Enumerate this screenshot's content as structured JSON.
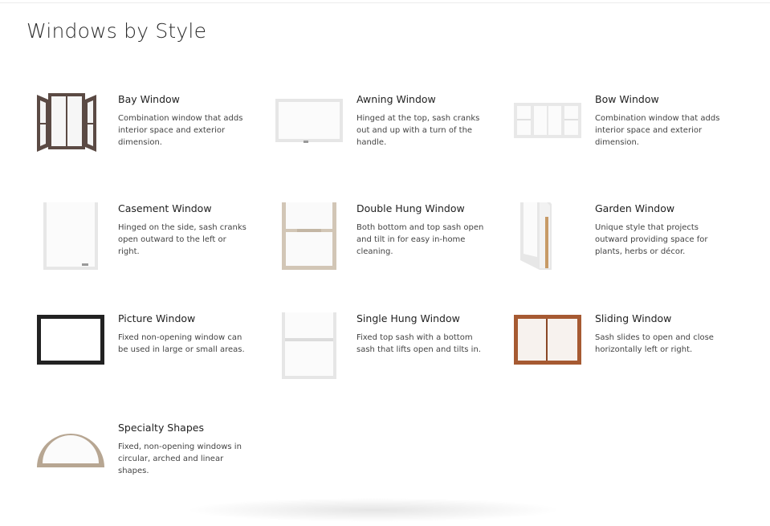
{
  "page": {
    "title": "Windows by Style"
  },
  "styles": [
    {
      "name": "Bay Window",
      "desc": "Combination window that adds interior space and exterior dimension.",
      "icon": "bay-window-icon"
    },
    {
      "name": "Awning Window",
      "desc": "Hinged at the top, sash cranks out and up with a turn of the handle.",
      "icon": "awning-window-icon"
    },
    {
      "name": "Bow Window",
      "desc": "Combination window that adds interior space and exterior dimension.",
      "icon": "bow-window-icon"
    },
    {
      "name": "Casement Window",
      "desc": "Hinged on the side, sash cranks open outward to the left or right.",
      "icon": "casement-window-icon"
    },
    {
      "name": "Double Hung Window",
      "desc": "Both bottom and top sash open and tilt in for easy in-home cleaning.",
      "icon": "double-hung-window-icon"
    },
    {
      "name": "Garden Window",
      "desc": "Unique style that projects outward providing space for plants, herbs or décor.",
      "icon": "garden-window-icon"
    },
    {
      "name": "Picture Window",
      "desc": "Fixed non-opening window can be used in large or small areas.",
      "icon": "picture-window-icon"
    },
    {
      "name": "Single Hung Window",
      "desc": "Fixed top sash with a bottom sash that lifts open and tilts in.",
      "icon": "single-hung-window-icon"
    },
    {
      "name": "Sliding Window",
      "desc": "Sash slides to open and close horizontally left or right.",
      "icon": "sliding-window-icon"
    },
    {
      "name": "Specialty Shapes",
      "desc": "Fixed, non-opening windows in circular, arched and linear shapes.",
      "icon": "specialty-shapes-icon"
    }
  ],
  "colors": {
    "bay_frame": "#5b4a44",
    "white_frame": "#e9e9e9",
    "tan_frame": "#d2c6b6",
    "black_frame": "#222222",
    "wood_frame": "#a65a32",
    "arch_frame": "#b7a692"
  }
}
